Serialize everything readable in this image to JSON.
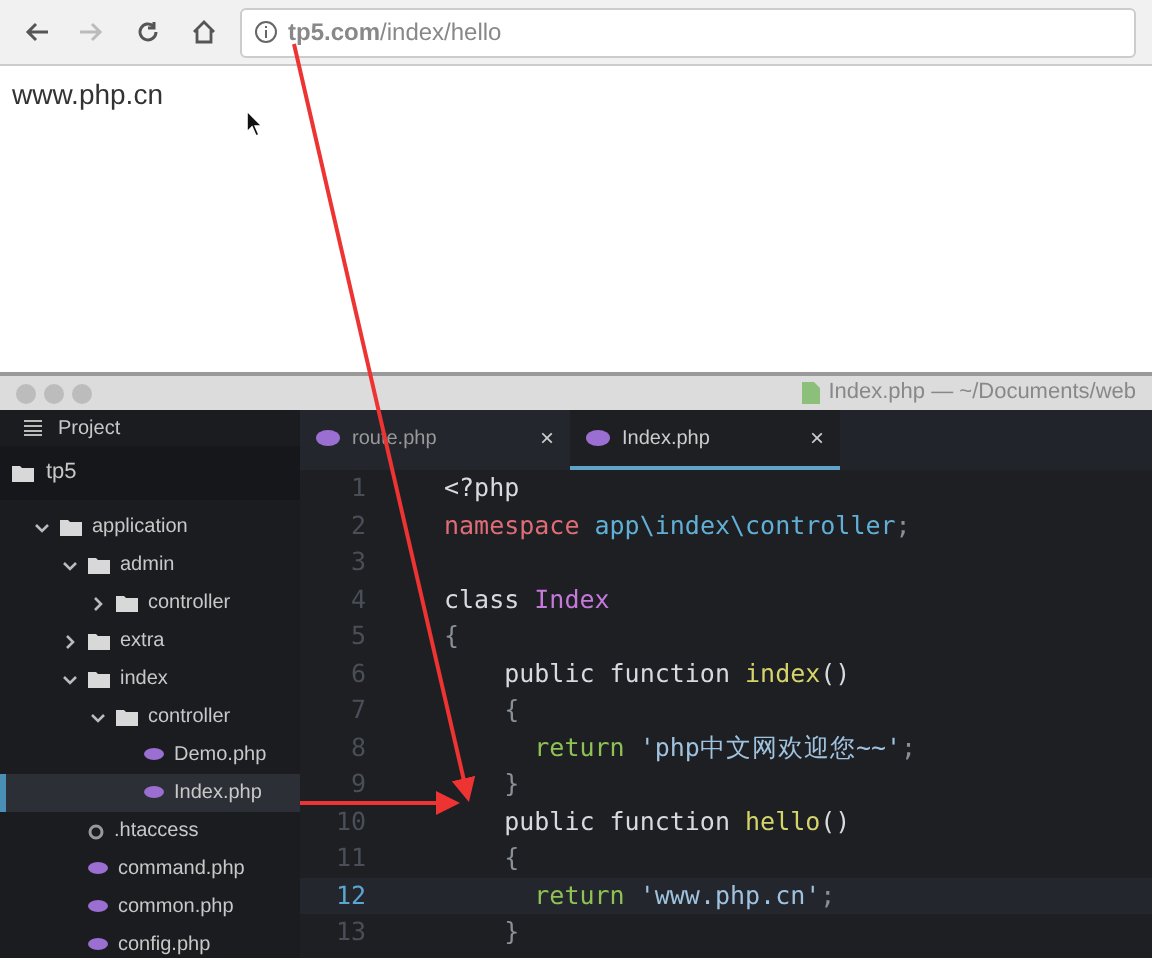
{
  "browser": {
    "nav": [
      {
        "kind": "back",
        "disabled": false
      },
      {
        "kind": "forward",
        "disabled": true
      },
      {
        "kind": "reload",
        "disabled": false
      },
      {
        "kind": "home",
        "disabled": false
      }
    ],
    "url": "**tp5.com**/index/hello",
    "page_text": "www.php.cn"
  },
  "editor": {
    "title": "Index.php — ~/Documents/web",
    "sidebar": {
      "title": "Project",
      "root": "tp5",
      "tree": [
        {
          "label": "application",
          "kind": "folder",
          "expanded": true,
          "selected": false,
          "children": [
            {
              "label": "admin",
              "kind": "folder",
              "expanded": true,
              "selected": false,
              "children": [
                {
                  "label": "controller",
                  "kind": "folder",
                  "expanded": false,
                  "selected": false
                }
              ]
            },
            {
              "label": "extra",
              "kind": "folder",
              "expanded": false,
              "selected": false
            },
            {
              "label": "index",
              "kind": "folder",
              "expanded": true,
              "selected": false,
              "children": [
                {
                  "label": "controller",
                  "kind": "folder",
                  "expanded": true,
                  "selected": false,
                  "children": [
                    {
                      "label": "Demo.php",
                      "kind": "php",
                      "selected": false
                    },
                    {
                      "label": "Index.php",
                      "kind": "php",
                      "selected": true
                    }
                  ]
                }
              ]
            },
            {
              "label": ".htaccess",
              "kind": "config",
              "selected": false
            },
            {
              "label": "command.php",
              "kind": "php",
              "selected": false
            },
            {
              "label": "common.php",
              "kind": "php",
              "selected": false
            },
            {
              "label": "config.php",
              "kind": "php",
              "selected": false
            }
          ]
        }
      ]
    },
    "tabs": [
      {
        "label": "route.php",
        "selected": false,
        "close": "×"
      },
      {
        "label": "Index.php",
        "selected": true,
        "close": "×"
      }
    ],
    "code": [
      {
        "number": "1",
        "current": false,
        "tokens": [
          {
            "kind": "plain",
            "text": "<?php"
          }
        ]
      },
      {
        "number": "2",
        "current": false,
        "tokens": [
          {
            "kind": "keyword",
            "text": "namespace"
          },
          {
            "kind": "namespace",
            "text": " app\\index\\controller"
          },
          {
            "kind": "punct",
            "text": ";"
          }
        ]
      },
      {
        "number": "3",
        "current": false
      },
      {
        "number": "4",
        "current": false,
        "tokens": [
          {
            "kind": "plain",
            "text": "class "
          },
          {
            "kind": "class",
            "text": "Index"
          }
        ]
      },
      {
        "number": "5",
        "current": false,
        "tokens": [
          {
            "kind": "punct",
            "text": "{"
          }
        ]
      },
      {
        "number": "6",
        "current": false,
        "tokens": [
          {
            "kind": "plain",
            "text": "    public function "
          },
          {
            "kind": "function",
            "text": "index"
          },
          {
            "kind": "plain",
            "text": "()"
          }
        ]
      },
      {
        "number": "7",
        "current": false,
        "tokens": [
          {
            "kind": "punct",
            "text": "    {"
          }
        ]
      },
      {
        "number": "8",
        "current": false,
        "tokens": [
          {
            "kind": "return",
            "text": "      return "
          },
          {
            "kind": "string",
            "text": "'php中文网欢迎您~~'"
          },
          {
            "kind": "punct",
            "text": ";"
          }
        ]
      },
      {
        "number": "9",
        "current": false,
        "tokens": [
          {
            "kind": "punct",
            "text": "    }"
          }
        ]
      },
      {
        "number": "10",
        "current": false,
        "tokens": [
          {
            "kind": "plain",
            "text": "    public function "
          },
          {
            "kind": "function",
            "text": "hello"
          },
          {
            "kind": "plain",
            "text": "()"
          }
        ]
      },
      {
        "number": "11",
        "current": false,
        "tokens": [
          {
            "kind": "punct",
            "text": "    {"
          }
        ]
      },
      {
        "number": "12",
        "current": true,
        "tokens": [
          {
            "kind": "return",
            "text": "      return "
          },
          {
            "kind": "string",
            "text": "'www.php.cn'"
          },
          {
            "kind": "punct",
            "text": ";"
          }
        ]
      },
      {
        "number": "13",
        "current": false,
        "tokens": [
          {
            "kind": "punct",
            "text": "    }"
          }
        ]
      }
    ]
  }
}
